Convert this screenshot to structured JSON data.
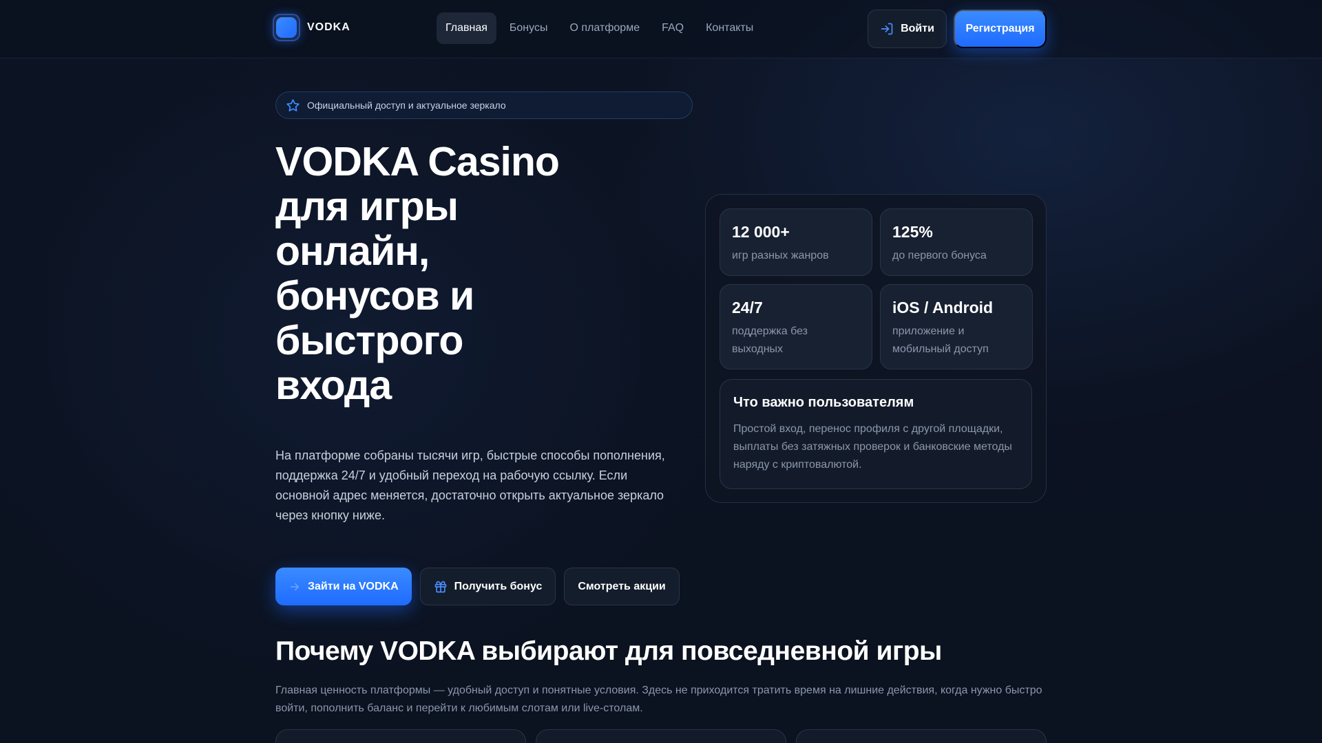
{
  "brand": {
    "name": "VODKA",
    "accent": "#1f6bff"
  },
  "nav": {
    "items": [
      {
        "label": "Главная",
        "active": true
      },
      {
        "label": "Бонусы"
      },
      {
        "label": "О платформе"
      },
      {
        "label": "FAQ"
      },
      {
        "label": "Контакты"
      }
    ]
  },
  "header": {
    "login_label": "Войти",
    "login_icon": "login-icon",
    "register_label": "Регистрация"
  },
  "hero": {
    "badge": "Официальный доступ и актуальное зеркало",
    "badge_icon": "star-icon",
    "title_lines": [
      "VODKA Casino",
      "для игры",
      "онлайн,",
      "бонусов и",
      "быстрого",
      "входа"
    ],
    "description": "На платформе собраны тысячи игр, быстрые способы пополнения, поддержка 24/7 и удобный переход на рабочую ссылку. Если основной адрес меняется, достаточно открыть актуальное зеркало через кнопку ниже.",
    "cta": {
      "enter_label": "Зайти на VODKA",
      "enter_icon": "arrow-right-icon",
      "bonus_label": "Получить бонус",
      "bonus_icon": "gift-icon",
      "promos_label": "Смотреть акции"
    }
  },
  "stats": [
    {
      "value": "12 000+",
      "label": "игр разных жанров"
    },
    {
      "value": "125%",
      "label": "до первого бонуса"
    },
    {
      "value": "24/7",
      "label": "поддержка без выходных"
    },
    {
      "value": "iOS / Android",
      "label": "приложение и мобильный доступ"
    }
  ],
  "info": {
    "title": "Что важно пользователям",
    "text": "Простой вход, перенос профиля с другой площадки, выплаты без затяжных проверок и банковские методы наряду с криптовалютой."
  },
  "section": {
    "title": "Почему VODKA выбирают для повседневной игры",
    "description": "Главная ценность платформы — удобный доступ и понятные условия. Здесь не приходится тратить время на лишние действия, когда нужно быстро войти, пополнить баланс и перейти к любимым слотам или live-столам."
  }
}
